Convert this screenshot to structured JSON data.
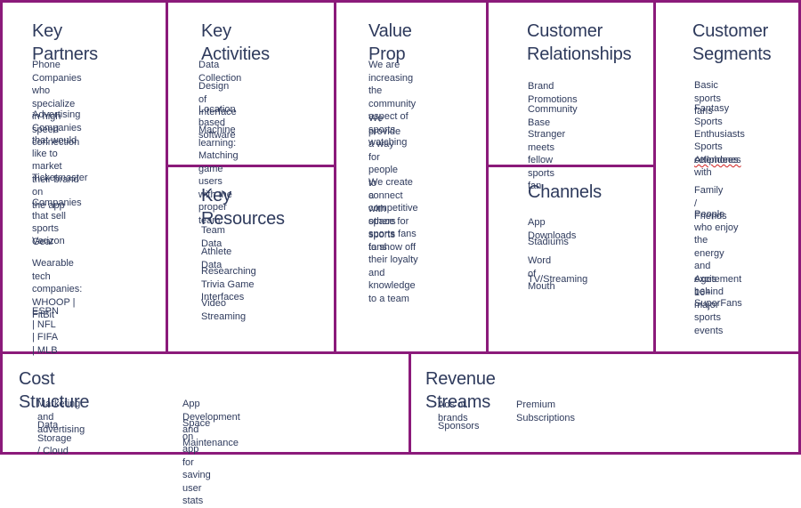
{
  "colors": {
    "border": "#8b1a7a",
    "text": "#2e3a5c",
    "background": "#ffffff"
  },
  "key_partners": {
    "title": "Key Partners",
    "items": [
      "Phone Companies who\nspecialize in high\nspeed connection",
      "Advertising Companies\nthat would like to\nmarket their brand on\nthe app",
      "Ticketmaster",
      "Companies that sell\nsports Gear",
      "Verizon",
      "Wearable tech\ncompanies: WHOOP |\nFitBit",
      "ESPN | NFL | FIFA | MLB"
    ]
  },
  "key_activities": {
    "title": "Key Activities",
    "items": [
      "Data Collection",
      "Design of Interface",
      "Location based software",
      "Machine learning: Matching\ngame users with the proper\nteam"
    ]
  },
  "key_resources": {
    "title": "Key Resources",
    "items": [
      "Team Data",
      "Athlete Data",
      "Researching Trivia Game\nInterfaces",
      "Video Streaming"
    ]
  },
  "value_prop": {
    "title": "Value Prop",
    "items": [
      "We are increasing the\ncommunity aspect of\nsports watching",
      "We provide a way for\npeople to connect with\nothers sports fans",
      "We create a\ncompetitive space for\nsports fans to show off\ntheir loyalty and\nknowledge to a team"
    ]
  },
  "customer_relationships": {
    "title": "Customer\nRelationships",
    "items": [
      "Brand Promotions",
      "Community Base",
      "Stranger meets fellow\nsports fan"
    ]
  },
  "channels": {
    "title": "Channels",
    "items": [
      "App Downloads",
      "Stadiums",
      "Word of Mouth",
      "TV/Streaming"
    ]
  },
  "customer_segments": {
    "title": "Customer\nSegments",
    "items": [
      "Basic sports fans",
      "Fantasy Sports\nEnthusiasts",
      "Sports Attendees with",
      "cellphones",
      "Family / Friends",
      "People who enjoy the\nenergy and excitement\nbehind major sports\nevents",
      "Ages 16+",
      "SuperFans"
    ]
  },
  "cost_structure": {
    "title": "Cost Structure",
    "items": [
      "Marketing and advertising",
      "Data Storage / Cloud",
      "App Development and Maintenance",
      "Space on app for saving user stats"
    ]
  },
  "revenue_streams": {
    "title": "Revenue Streams",
    "items": [
      "Ads of brands",
      "Sponsors",
      "Premium Subscriptions"
    ]
  }
}
